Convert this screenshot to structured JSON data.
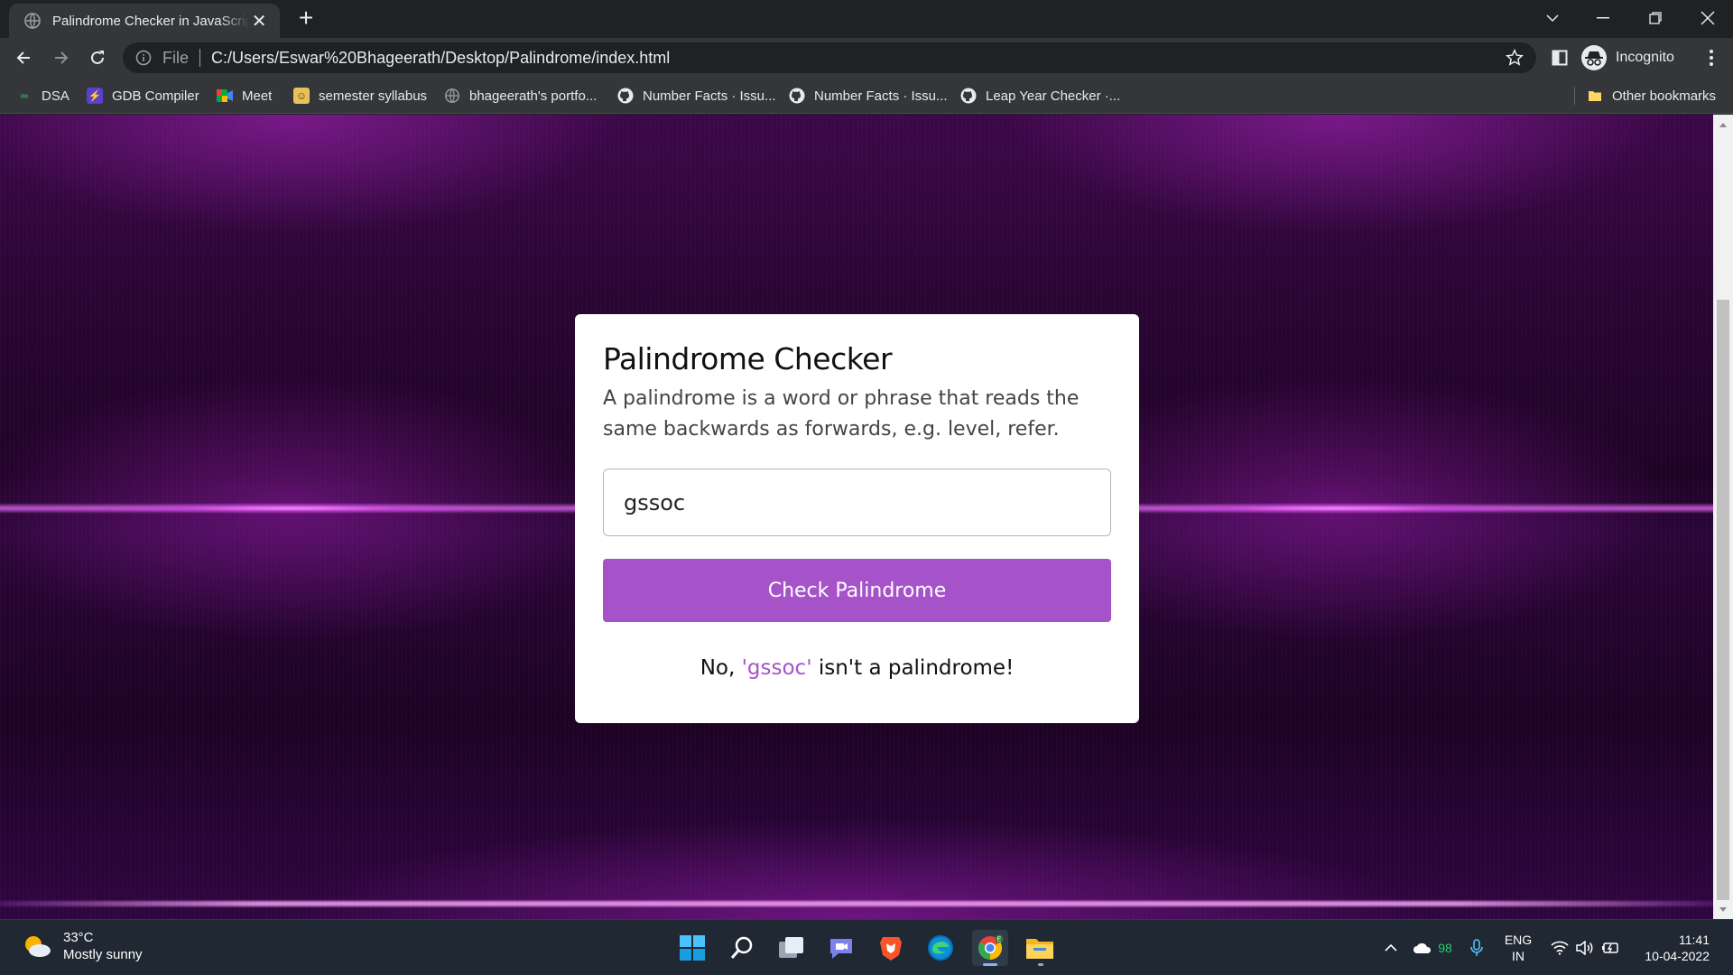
{
  "browser": {
    "tab_title": "Palindrome Checker in JavaScript",
    "new_tab_symbol": "+",
    "close_symbol": "✕",
    "omnibox": {
      "scheme_label": "File",
      "url": "C:/Users/Eswar%20Bhageerath/Desktop/Palindrome/index.html"
    },
    "profile_label": "Incognito",
    "bookmarks": [
      {
        "label": "DSA",
        "icon": "dsa-icon"
      },
      {
        "label": "GDB Compiler",
        "icon": "gdb-icon"
      },
      {
        "label": "Meet",
        "icon": "meet-icon"
      },
      {
        "label": "semester syllabus",
        "icon": "syllabus-icon"
      },
      {
        "label": "bhageerath's portfo...",
        "icon": "globe-icon"
      },
      {
        "label": "Number Facts · Issu...",
        "icon": "github-icon"
      },
      {
        "label": "Number Facts · Issu...",
        "icon": "github-icon"
      },
      {
        "label": "Leap Year Checker ·...",
        "icon": "github-icon"
      }
    ],
    "other_bookmarks": "Other bookmarks"
  },
  "app": {
    "title": "Palindrome Checker",
    "description": "A palindrome is a word or phrase that reads the same backwards as forwards, e.g. level, refer.",
    "input_value": "gssoc",
    "button_label": "Check Palindrome",
    "result": {
      "prefix": "No, ",
      "word": "'gssoc'",
      "suffix": " isn't a palindrome!"
    },
    "accent_color": "#a653c9"
  },
  "taskbar": {
    "weather": {
      "temp": "33°C",
      "condition": "Mostly sunny"
    },
    "apps": [
      "start-icon",
      "search-icon",
      "task-view-icon",
      "chat-icon",
      "brave-icon",
      "edge-icon",
      "chrome-icon",
      "file-explorer-icon"
    ],
    "tray": {
      "badge_count": "98",
      "language": "ENG",
      "region": "IN",
      "time": "11:41",
      "date": "10-04-2022"
    }
  }
}
